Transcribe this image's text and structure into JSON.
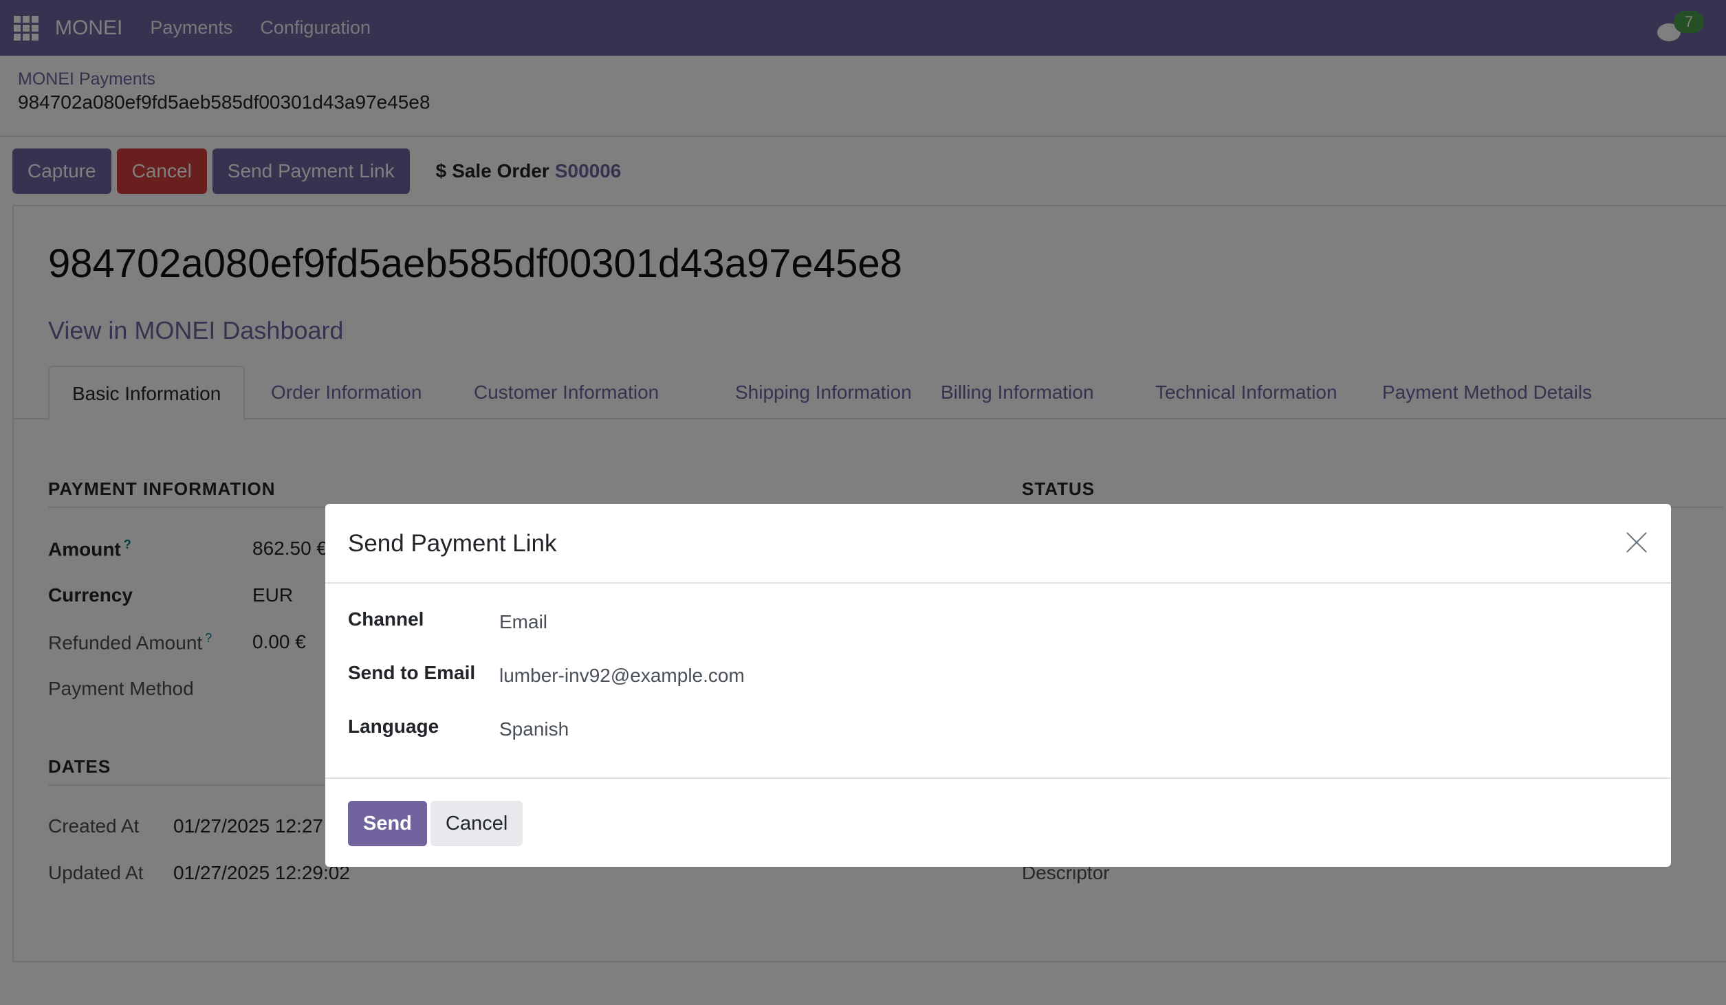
{
  "navbar": {
    "apps_icon": "apps-grid-icon",
    "brand": "MONEI",
    "menu": [
      "Payments",
      "Configuration"
    ],
    "chat_icon": "chat-icon",
    "chat_badge": "7"
  },
  "breadcrumb": {
    "parent": "MONEI Payments",
    "current": "984702a080ef9fd5aeb585df00301d43a97e45e8"
  },
  "actions": {
    "capture": "Capture",
    "cancel": "Cancel",
    "send_link": "Send Payment Link",
    "smart_icon": "$",
    "smart_label": "Sale Order",
    "smart_ref": "S00006"
  },
  "record": {
    "title": "984702a080ef9fd5aeb585df00301d43a97e45e8",
    "dashboard_link": "View in MONEI Dashboard"
  },
  "tabs": [
    {
      "label": "Basic Information",
      "active": true
    },
    {
      "label": "Order Information",
      "active": false
    },
    {
      "label": "Customer Information",
      "active": false
    },
    {
      "label": "Shipping Information",
      "active": false
    },
    {
      "label": "Billing Information",
      "active": false
    },
    {
      "label": "Technical Information",
      "active": false
    },
    {
      "label": "Payment Method Details",
      "active": false
    }
  ],
  "payment_info": {
    "title": "PAYMENT INFORMATION",
    "fields": [
      {
        "label": "Amount",
        "help": "?",
        "value": "862.50 €"
      },
      {
        "label": "Currency",
        "value": "EUR"
      },
      {
        "label": "Refunded Amount",
        "help": "?",
        "value": "0.00 €"
      },
      {
        "label": "Payment Method",
        "value": ""
      }
    ]
  },
  "status": {
    "title": "STATUS",
    "descriptor_label": "Descriptor"
  },
  "dates": {
    "title": "DATES",
    "fields": [
      {
        "label": "Created At",
        "value": "01/27/2025 12:27"
      },
      {
        "label": "Updated At",
        "value": "01/27/2025 12:29:02"
      }
    ]
  },
  "modal": {
    "title": "Send Payment Link",
    "fields": [
      {
        "label": "Channel",
        "value": "Email"
      },
      {
        "label": "Send to Email",
        "value": "lumber-inv92@example.com"
      },
      {
        "label": "Language",
        "value": "Spanish"
      }
    ],
    "send": "Send",
    "cancel": "Cancel"
  }
}
